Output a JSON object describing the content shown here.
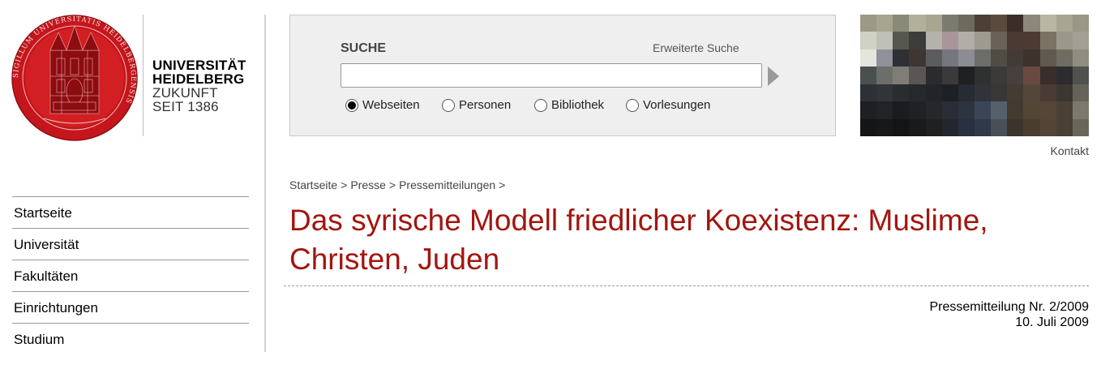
{
  "logo": {
    "line1": "UNIVERSITÄT",
    "line2": "HEIDELBERG",
    "line3": "ZUKUNFT",
    "line4": "SEIT 1386",
    "seal_color": "#c4161c",
    "seal_text": "SIGILLUM UNIVERSITATIS HEIDELBERGENSIS"
  },
  "search": {
    "title": "SUCHE",
    "advanced_label": "Erweiterte Suche",
    "input_value": "",
    "options": [
      {
        "label": "Webseiten",
        "checked": true
      },
      {
        "label": "Personen",
        "checked": false
      },
      {
        "label": "Bibliothek",
        "checked": false
      },
      {
        "label": "Vorlesungen",
        "checked": false
      }
    ]
  },
  "header": {
    "contact_label": "Kontakt"
  },
  "breadcrumb": [
    "Startseite",
    "Presse",
    "Pressemitteilungen"
  ],
  "breadcrumb_separator": ">",
  "article": {
    "title": "Das syrische Modell friedlicher Koexistenz: Muslime, Christen, Juden",
    "press_number": "Pressemitteilung Nr. 2/2009",
    "date": "10. Juli 2009"
  },
  "nav": {
    "items": [
      "Startseite",
      "Universität",
      "Fakultäten",
      "Einrichtungen",
      "Studium"
    ]
  },
  "colors": {
    "accent_red": "#a3150f",
    "seal_red": "#c4161c",
    "panel_bg": "#efefef"
  }
}
